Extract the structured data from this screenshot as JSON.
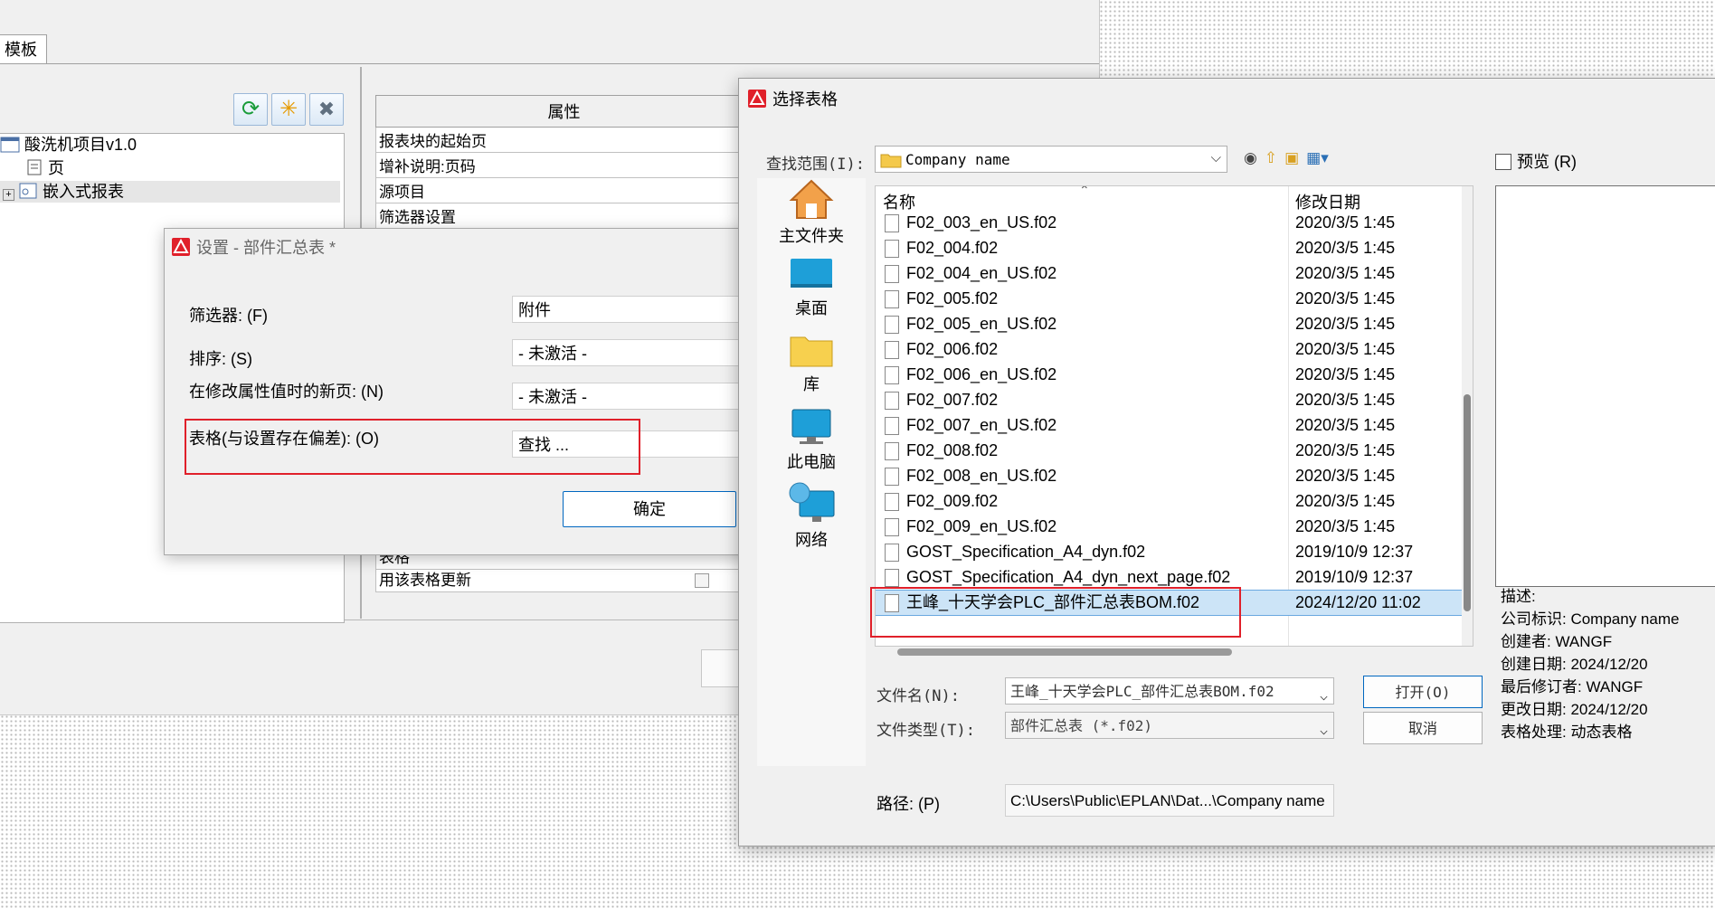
{
  "background_window": {
    "tab_label": "模板",
    "tree": [
      {
        "label": "酸洗机项目v1.0",
        "icon": "project-icon"
      },
      {
        "label": "页",
        "icon": "page-icon"
      },
      {
        "label": "嵌入式报表",
        "icon": "report-icon"
      }
    ],
    "toolbar": [
      {
        "name": "refresh-icon",
        "glyph": "⟳",
        "color": "#1a9c3a"
      },
      {
        "name": "new-icon",
        "glyph": "✳",
        "color": "#e69a00"
      },
      {
        "name": "delete-icon",
        "glyph": "✖",
        "color": "#607080"
      }
    ],
    "prop_table": {
      "header": "属性",
      "rows": [
        "报表块的起始页",
        "增补说明:页码",
        "源项目",
        "筛选器设置"
      ],
      "rows_lower": [
        "表格",
        "用该表格更新"
      ]
    }
  },
  "settings_dialog": {
    "title": "设置 - 部件汇总表 *",
    "fields": [
      {
        "label": "筛选器: (F)",
        "value": "附件"
      },
      {
        "label": "排序: (S)",
        "value": "- 未激活 -"
      },
      {
        "label": "在修改属性值时的新页: (N)",
        "value": "- 未激活 -"
      },
      {
        "label": "表格(与设置存在偏差): (O)",
        "value": "查找 ..."
      }
    ],
    "ok_label": "确定"
  },
  "chooser_dialog": {
    "title": "选择表格",
    "look_in_label": "查找范围(I):",
    "look_in_value": "Company name",
    "places": [
      {
        "label": "主文件夹",
        "icon": "home-folder-icon"
      },
      {
        "label": "桌面",
        "icon": "desktop-icon"
      },
      {
        "label": "库",
        "icon": "library-folder-icon"
      },
      {
        "label": "此电脑",
        "icon": "computer-icon"
      },
      {
        "label": "网络",
        "icon": "network-icon"
      }
    ],
    "columns": {
      "name": "名称",
      "date": "修改日期"
    },
    "files": [
      {
        "name": "F02_003_en_US.f02",
        "date": "2020/3/5 1:45"
      },
      {
        "name": "F02_004.f02",
        "date": "2020/3/5 1:45"
      },
      {
        "name": "F02_004_en_US.f02",
        "date": "2020/3/5 1:45"
      },
      {
        "name": "F02_005.f02",
        "date": "2020/3/5 1:45"
      },
      {
        "name": "F02_005_en_US.f02",
        "date": "2020/3/5 1:45"
      },
      {
        "name": "F02_006.f02",
        "date": "2020/3/5 1:45"
      },
      {
        "name": "F02_006_en_US.f02",
        "date": "2020/3/5 1:45"
      },
      {
        "name": "F02_007.f02",
        "date": "2020/3/5 1:45"
      },
      {
        "name": "F02_007_en_US.f02",
        "date": "2020/3/5 1:45"
      },
      {
        "name": "F02_008.f02",
        "date": "2020/3/5 1:45"
      },
      {
        "name": "F02_008_en_US.f02",
        "date": "2020/3/5 1:45"
      },
      {
        "name": "F02_009.f02",
        "date": "2020/3/5 1:45"
      },
      {
        "name": "F02_009_en_US.f02",
        "date": "2020/3/5 1:45"
      },
      {
        "name": "GOST_Specification_A4_dyn.f02",
        "date": "2019/10/9 12:37"
      },
      {
        "name": "GOST_Specification_A4_dyn_next_page.f02",
        "date": "2019/10/9 12:37"
      },
      {
        "name": "王峰_十天学会PLC_部件汇总表BOM.f02",
        "date": "2024/12/20 11:02",
        "selected": true
      }
    ],
    "filename_label": "文件名(N):",
    "filename_value": "王峰_十天学会PLC_部件汇总表BOM.f02",
    "filetype_label": "文件类型(T):",
    "filetype_value": "部件汇总表 (*.f02)",
    "open_label": "打开(O)",
    "cancel_label": "取消",
    "path_label": "路径: (P)",
    "path_value": "C:\\Users\\Public\\EPLAN\\Dat...\\Company name",
    "preview_label": "预览 (R)",
    "description": [
      "描述:",
      "公司标识: Company name",
      "创建者: WANGF",
      "创建日期: 2024/12/20",
      "最后修订者: WANGF",
      "更改日期: 2024/12/20",
      "表格处理: 动态表格"
    ],
    "nav_icons": [
      "back-icon",
      "up-folder-icon",
      "new-folder-icon",
      "view-menu-icon"
    ]
  },
  "colors": {
    "highlight_red": "#e0202a",
    "selection": "#cce4f7",
    "accent": "#0067c0"
  }
}
